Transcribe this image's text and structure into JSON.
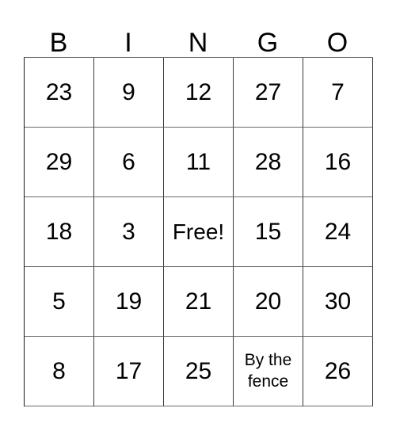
{
  "card": {
    "header_letters": [
      "B",
      "I",
      "N",
      "G",
      "O"
    ],
    "rows": [
      [
        {
          "text": "23",
          "kind": "number"
        },
        {
          "text": "9",
          "kind": "number"
        },
        {
          "text": "12",
          "kind": "number"
        },
        {
          "text": "27",
          "kind": "number"
        },
        {
          "text": "7",
          "kind": "number"
        }
      ],
      [
        {
          "text": "29",
          "kind": "number"
        },
        {
          "text": "6",
          "kind": "number"
        },
        {
          "text": "11",
          "kind": "number"
        },
        {
          "text": "28",
          "kind": "number"
        },
        {
          "text": "16",
          "kind": "number"
        }
      ],
      [
        {
          "text": "18",
          "kind": "number"
        },
        {
          "text": "3",
          "kind": "number"
        },
        {
          "text": "Free!",
          "kind": "free"
        },
        {
          "text": "15",
          "kind": "number"
        },
        {
          "text": "24",
          "kind": "number"
        }
      ],
      [
        {
          "text": "5",
          "kind": "number"
        },
        {
          "text": "19",
          "kind": "number"
        },
        {
          "text": "21",
          "kind": "number"
        },
        {
          "text": "20",
          "kind": "number"
        },
        {
          "text": "30",
          "kind": "number"
        }
      ],
      [
        {
          "text": "8",
          "kind": "number"
        },
        {
          "text": "17",
          "kind": "number"
        },
        {
          "text": "25",
          "kind": "number"
        },
        {
          "text": "By the fence",
          "kind": "wordy"
        },
        {
          "text": "26",
          "kind": "number"
        }
      ]
    ],
    "colors": {
      "background": "#ffffff",
      "text": "#000000",
      "grid_line": "#6b6b6b"
    }
  }
}
